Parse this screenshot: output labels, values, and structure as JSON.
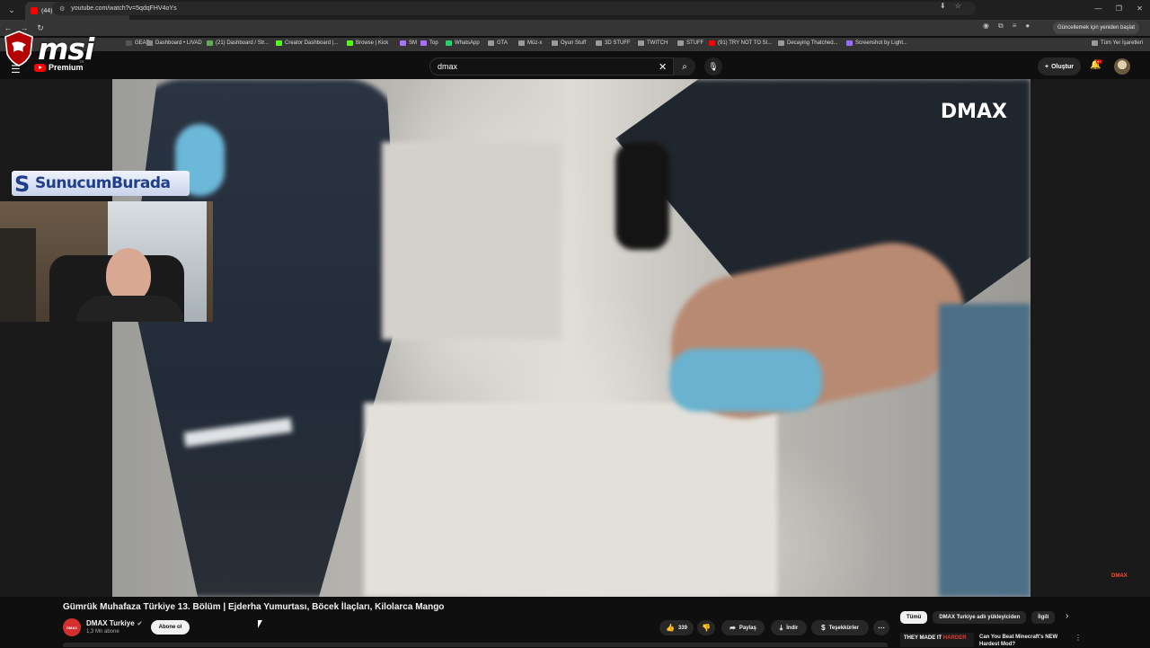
{
  "browser": {
    "tab_title": "(44) Gümrük Muhafaza Türk",
    "new_tab": "+",
    "url": "youtube.com/watch?v=5qdqFHV4oYs",
    "update_label": "Güncellemek için yeniden başlat",
    "bookmarks": [
      {
        "label": "GEAR",
        "color": "#555"
      },
      {
        "label": "Dashboard • LIVAD",
        "color": "#888"
      },
      {
        "label": "(21) Dashboard / Str...",
        "color": "#6a5"
      },
      {
        "label": "Creator Dashboard |...",
        "color": "#53fc18"
      },
      {
        "label": "Browse | Kick",
        "color": "#53fc18"
      },
      {
        "label": "SM",
        "color": "#a970ff"
      },
      {
        "label": "Top",
        "color": "#a970ff"
      },
      {
        "label": "WhatsApp",
        "color": "#25d366"
      },
      {
        "label": "GTA",
        "color": "#999"
      },
      {
        "label": "Müz-x",
        "color": "#999"
      },
      {
        "label": "Oyun Stuff",
        "color": "#999"
      },
      {
        "label": "3D STUFF",
        "color": "#999"
      },
      {
        "label": "TWITCH",
        "color": "#999"
      },
      {
        "label": "STUFF",
        "color": "#999"
      },
      {
        "label": "(91) TRY NOT TO SI...",
        "color": "#ff0000"
      },
      {
        "label": "Decaying Thatched...",
        "color": "#999"
      },
      {
        "label": "Screenshot by Light...",
        "color": "#9b6bff"
      }
    ],
    "all_bookmarks": "Tüm Yer İşaretleri"
  },
  "overlay": {
    "msi_logo": "msi",
    "sponsor_banner": "SunucumBurada",
    "sponsor_logo": "S"
  },
  "youtube": {
    "logo_text": "Premium",
    "region": "TR",
    "search_value": "dmax",
    "create_label": "Oluştur",
    "notif_count": "9+",
    "watermark": "DMAX",
    "mini_watermark": "DMAX"
  },
  "video": {
    "title": "Gümrük Muhafaza Türkiye 13. Bölüm | Ejderha Yumurtası, Böcek İlaçları, Kilolarca Mango",
    "channel_avatar": "DMAX",
    "channel_name": "DMAX Turkiye",
    "subscribers": "1,3 Mn abone",
    "subscribe_label": "Abone ol",
    "likes": "339",
    "share_label": "Paylaş",
    "download_label": "İndir",
    "thanks_label": "Teşekkürler"
  },
  "sidebar": {
    "chips": [
      {
        "label": "Tümü",
        "active": true
      },
      {
        "label": "DMAX Turkiye adlı yükleyiciden",
        "active": false
      },
      {
        "label": "İlgili",
        "active": false
      }
    ],
    "rec_thumb_text_a": "THEY MADE IT",
    "rec_thumb_text_b": "HARDER",
    "rec_title": "Can You Beat Minecraft's NEW Hardest Mod?"
  }
}
